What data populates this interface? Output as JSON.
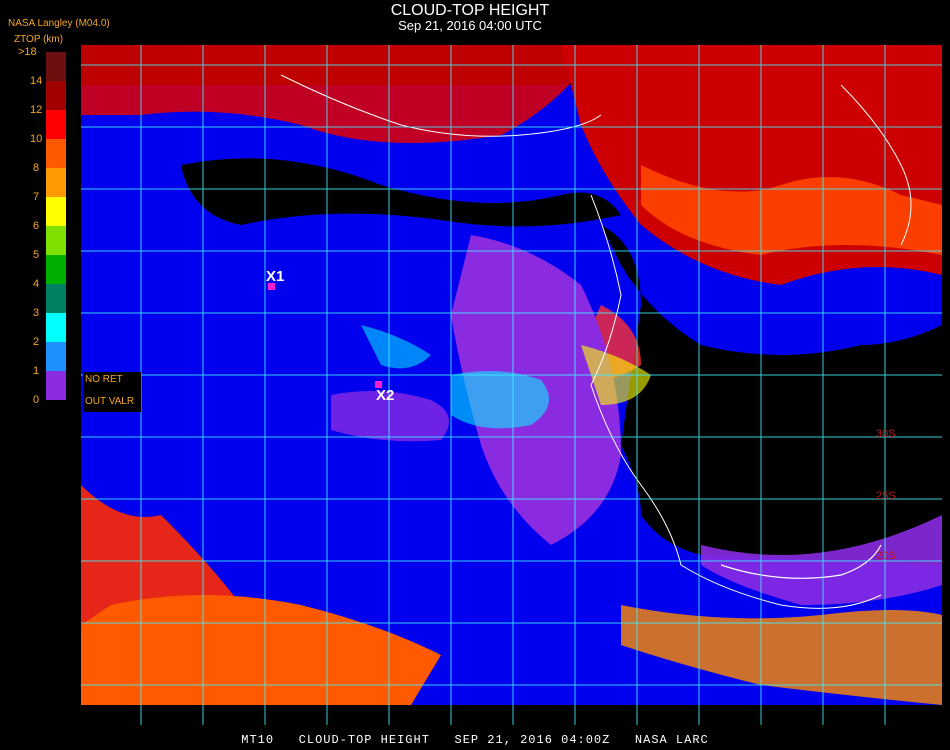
{
  "header": {
    "title": "CLOUD-TOP HEIGHT",
    "subtitle": "Sep 21, 2016 04:00 UTC",
    "provider": "NASA Langley (M04.0)",
    "unit_label": "ZTOP (km)"
  },
  "legend": {
    "ticks": [
      ">18",
      "14",
      "12",
      "10",
      "8",
      "7",
      "6",
      "5",
      "4",
      "3",
      "2",
      "1",
      "0"
    ],
    "colors": [
      "#6b0f0f",
      "#a00000",
      "#ff0000",
      "#ff5a00",
      "#ff9a00",
      "#ffff00",
      "#80e000",
      "#00b000",
      "#008060",
      "#00ffff",
      "#1e90ff",
      "#0000ff",
      "#8a2be2"
    ],
    "no_retrieval": "NO RET",
    "out_valid": "OUT VALR"
  },
  "markers": [
    {
      "label": "X1"
    },
    {
      "label": "X2"
    }
  ],
  "map_labels": [
    "30S",
    "25S",
    "20S"
  ],
  "footer": "MT10   CLOUD-TOP HEIGHT   SEP 21, 2016 04:00Z   NASA LARC"
}
